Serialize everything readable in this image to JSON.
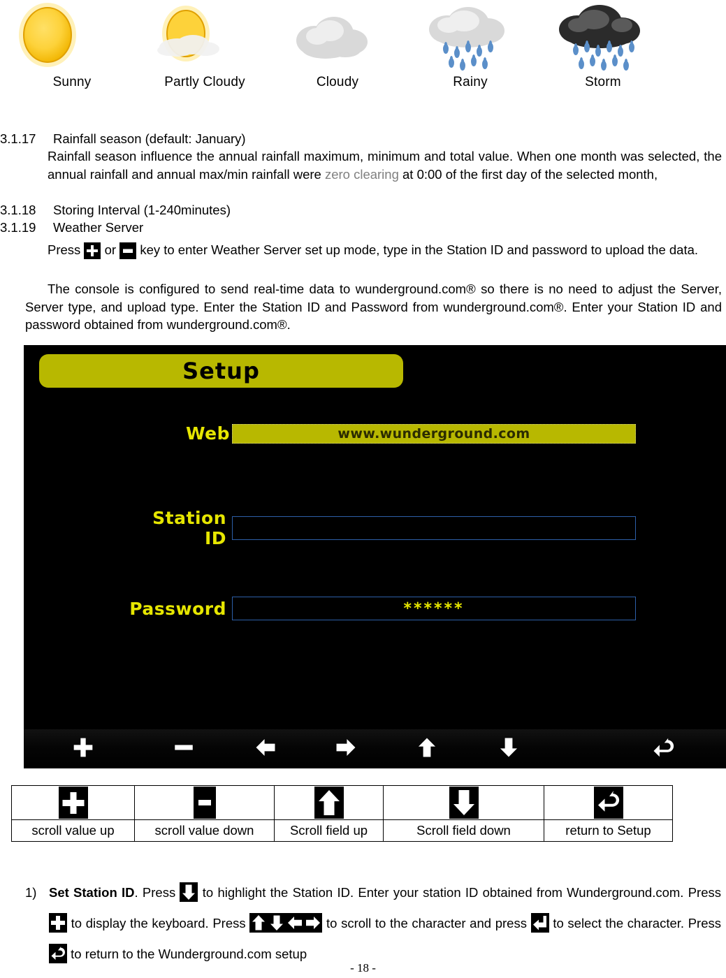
{
  "weather_legend": {
    "items": [
      {
        "label": "Sunny",
        "icon": "sun-icon"
      },
      {
        "label": "Partly Cloudy",
        "icon": "sun-behind-cloud-icon"
      },
      {
        "label": "Cloudy",
        "icon": "cloud-icon"
      },
      {
        "label": "Rainy",
        "icon": "rain-cloud-icon"
      },
      {
        "label": "Storm",
        "icon": "storm-cloud-icon"
      }
    ]
  },
  "sections": {
    "s_3_1_17": {
      "number": "3.1.17",
      "title": "Rainfall season (default: January)",
      "body_a": "Rainfall season influence the annual rainfall maximum, minimum and total value. When one month was selected, the annual rainfall and annual max/min rainfall were ",
      "body_highlight": "zero clearing",
      "body_b": " at 0:00 of the first day of the selected month,"
    },
    "s_3_1_18": {
      "number": "3.1.18",
      "title": "Storing Interval (1-240minutes)"
    },
    "s_3_1_19": {
      "number": "3.1.19",
      "title": "Weather Server",
      "press_prefix": "Press",
      "press_or": "or",
      "press_suffix": "key to enter Weather Server set up mode, type in the Station ID and password to upload the data.",
      "paragraph2": "The console is configured to send real-time data to wunderground.com® so there is no need to adjust the Server, Server type, and upload type. Enter the Station ID and Password from wunderground.com®. Enter your Station ID and password obtained from wunderground.com®."
    }
  },
  "lcd": {
    "title": "Setup",
    "title_color": "#b8b800",
    "label_color": "#e6e600",
    "field_border_color": "#2d5fa8",
    "rows": [
      {
        "label": "Web",
        "value": "www.wunderground.com",
        "type": "filled"
      },
      {
        "label": "Station ID",
        "value": "",
        "type": "input"
      },
      {
        "label": "Password",
        "value": "******",
        "type": "input"
      }
    ],
    "toolbar": [
      {
        "icon": "plus-icon"
      },
      {
        "icon": "minus-icon"
      },
      {
        "icon": "arrow-left-icon"
      },
      {
        "icon": "arrow-right-icon"
      },
      {
        "icon": "arrow-up-icon"
      },
      {
        "icon": "arrow-down-icon"
      },
      {
        "icon": "return-icon"
      }
    ]
  },
  "legend_table": {
    "columns": [
      {
        "icon": "plus-icon",
        "label": "scroll value up"
      },
      {
        "icon": "minus-icon",
        "label": "scroll value down"
      },
      {
        "icon": "arrow-up-icon",
        "label": "Scroll field up"
      },
      {
        "icon": "arrow-down-icon",
        "label": "Scroll field down"
      },
      {
        "icon": "return-icon",
        "label": "return to Setup"
      }
    ]
  },
  "step": {
    "marker": "1)",
    "bold_lead": "Set Station ID",
    "t1": ".   Press",
    "t2": "to highlight the Station ID. Enter your station ID obtained from Wunderground.com. Press",
    "t3": "to display the keyboard. Press",
    "t4": "to scroll to the character and press",
    "t5": "to select the character. Press",
    "t6": "to return to the Wunderground.com setup"
  },
  "page_number": "- 18 -"
}
